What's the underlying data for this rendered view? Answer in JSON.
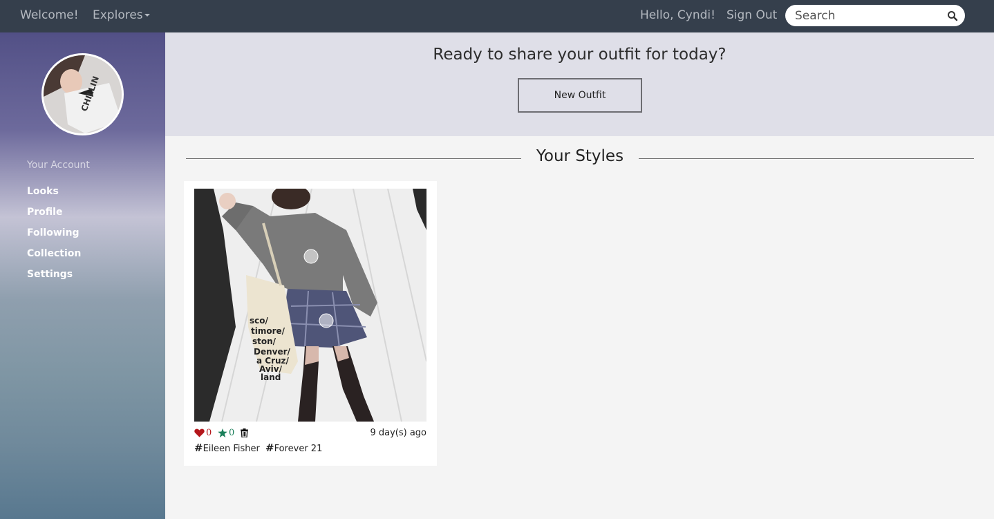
{
  "navbar": {
    "welcome": "Welcome!",
    "explores": "Explores",
    "greeting": "Hello, Cyndi!",
    "sign_out": "Sign Out",
    "search_placeholder": "Search"
  },
  "sidebar": {
    "heading": "Your Account",
    "items": [
      {
        "label": "Looks"
      },
      {
        "label": "Profile"
      },
      {
        "label": "Following"
      },
      {
        "label": "Collection"
      },
      {
        "label": "Settings"
      }
    ],
    "avatar_shirt_text": "CHILLIN"
  },
  "hero": {
    "title": "Ready to share your outfit for today?",
    "button_label": "New Outfit"
  },
  "section": {
    "title": "Your Styles"
  },
  "card": {
    "likes": "0",
    "stars": "0",
    "time_ago": "9 day(s) ago",
    "tags": [
      {
        "hash": "#",
        "label": "Eileen Fisher"
      },
      {
        "hash": "#",
        "label": "Forever 21"
      }
    ],
    "bag_text": [
      "sco/",
      "timore/",
      "ston/",
      "Denver/",
      "a Cruz/",
      "Aviv/",
      "land"
    ]
  },
  "colors": {
    "navbar_bg": "#353f4c",
    "heart": "#b4161b",
    "star": "#1a7f5a",
    "hero_bg": "#dfdfe8"
  }
}
